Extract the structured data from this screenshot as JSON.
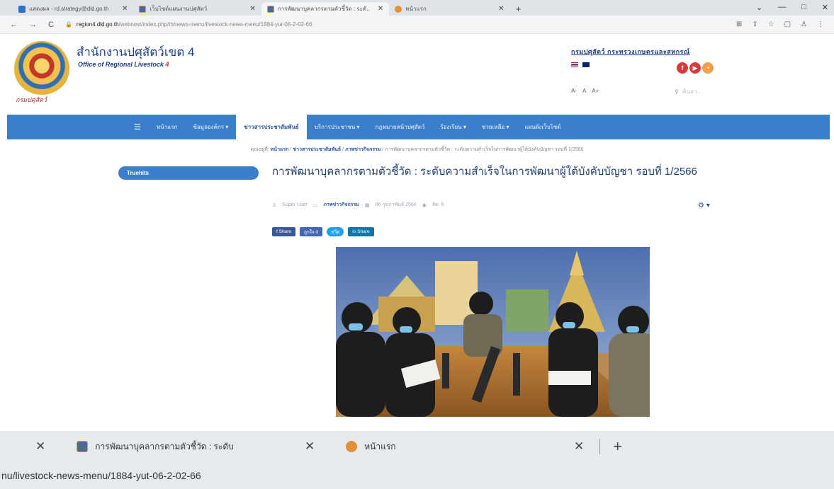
{
  "browser": {
    "tabs": [
      {
        "title": "แสดงผล - rd.strategy@dld.go.th",
        "fav": "mail-icon"
      },
      {
        "title": "เว็บไซต์แผนงานปศุสัตว์",
        "fav": "site-logo-icon"
      },
      {
        "title": "การพัฒนาบุคลากรตามตัวชี้วัด : ระดั...",
        "fav": "site-logo-icon",
        "active": true
      },
      {
        "title": "หน้าแรก",
        "fav": "rss-icon"
      }
    ],
    "window_controls": [
      "⌄",
      "—",
      "□",
      "✕"
    ],
    "url_host": "region4.dld.go.th",
    "url_path": "/webnew/index.php/th/news-menu/livestock-news-menu/1884-yut-06-2-02-66",
    "toolbar_icons": [
      "translate-icon",
      "share-icon",
      "star-icon",
      "sidebar-icon",
      "profile-icon",
      "menu-icon"
    ]
  },
  "header": {
    "title_th": "สำนักงานปศุสัตว์เขต 4",
    "title_en": "Office of Regional Livestock",
    "title_en_num": "4",
    "logo_caption": "กรมปศุสัตว์",
    "dept_links": "กรมปศุสัตว์  กระทรวงเกษตรและสหกรณ์",
    "font_sizes": [
      "A-",
      "A",
      "A+"
    ],
    "search_placeholder": "ค้นหา...",
    "social": [
      "f",
      "▶",
      "◔"
    ]
  },
  "nav": {
    "items": [
      {
        "label": "หน้าแรก"
      },
      {
        "label": "ข้อมูลองค์กร ▾"
      },
      {
        "label": "ข่าวสารประชาสัมพันธ์",
        "active": true
      },
      {
        "label": "บริการประชาชน ▾"
      },
      {
        "label": "กฎหมายหน้าปศุสัตว์"
      },
      {
        "label": "ร้องเรียน ▾"
      },
      {
        "label": "ช่วยเหลือ ▾"
      },
      {
        "label": "แผนผังเว็บไซต์"
      }
    ]
  },
  "breadcrumb": {
    "prefix": "คุณอยู่ที่:",
    "items": [
      "หน้าแรก",
      "ข่าวสารประชาสัมพันธ์",
      "ภาพข่าวกิจกรรม"
    ],
    "current": "การพัฒนาบุคลากรตามตัวชี้วัด : ระดับความสำเร็จในการพัฒนาผู้ใต้บังคับบัญชา รอบที่ 1/2566"
  },
  "sidebar": {
    "label": "Truehits"
  },
  "article": {
    "title": "การพัฒนาบุคลากรตามตัวชี้วัด : ระดับความสำเร็จในการพัฒนาผู้ใต้บังคับบัญชา รอบที่ 1/2566",
    "author": "Super User",
    "category": "ภาพข่าวกิจกรรม",
    "date": "06 กุมภาพันธ์ 2566",
    "views": "ฮิต: 6",
    "share": {
      "fb": "f Share",
      "like": "ถูกใจ 0",
      "tw": "ทวีต",
      "li": "in Share"
    }
  },
  "overlay": {
    "tab1_title": "การพัฒนาบุคลากรตามตัวชี้วัด : ระดับ",
    "tab2_title": "หน้าแรก",
    "status_url": "nu/livestock-news-menu/1884-yut-06-2-02-66"
  }
}
